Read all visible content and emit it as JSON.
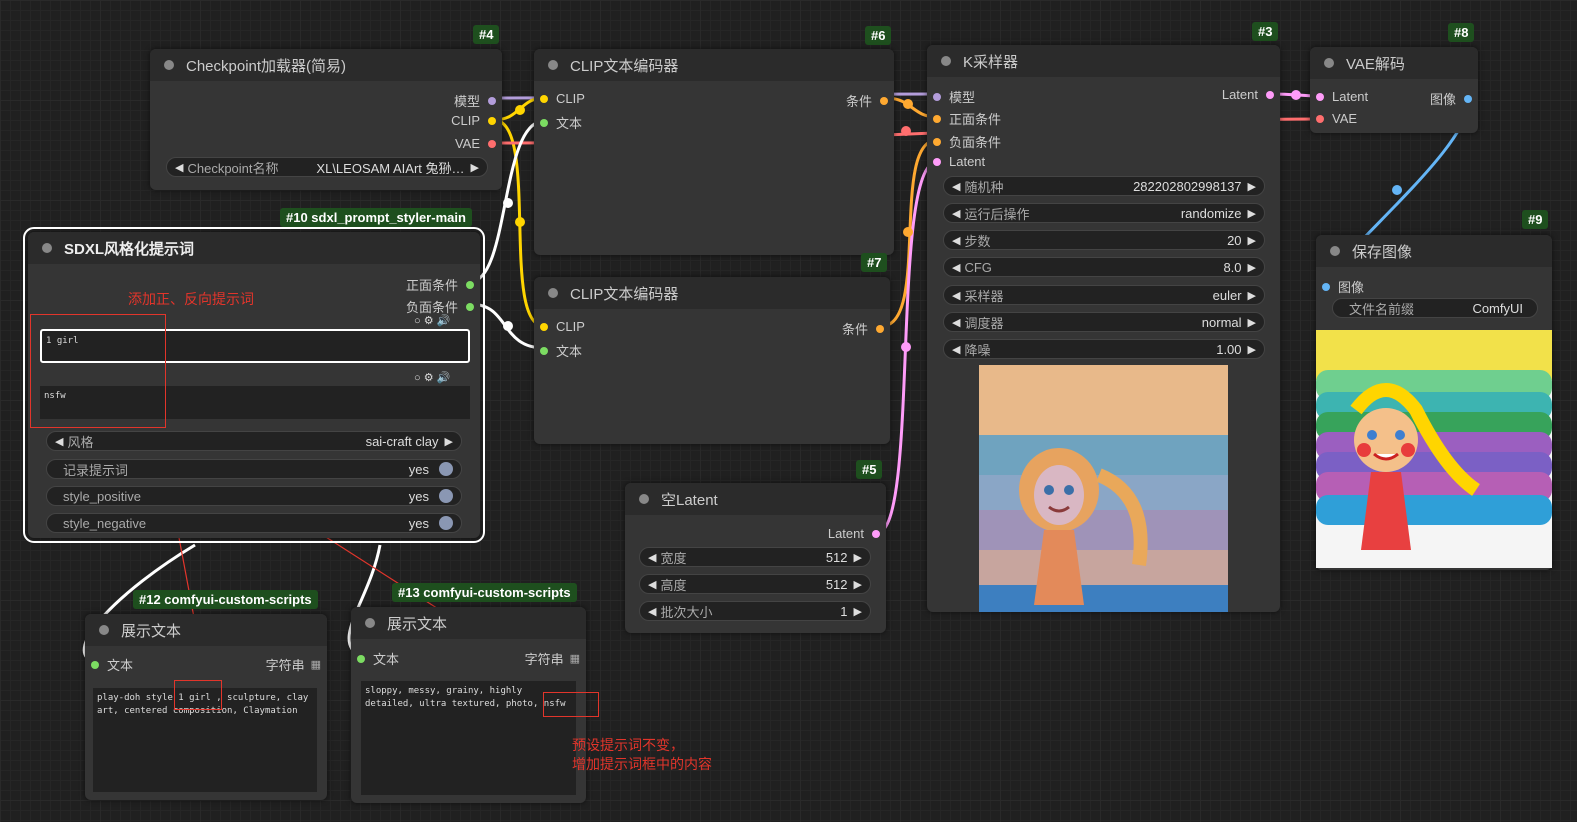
{
  "colors": {
    "model": "#b39ddb",
    "clip": "#ffd500",
    "vae": "#ff6e6e",
    "cond": "#ffa931",
    "latent": "#ff9cf9",
    "image": "#64b5f6",
    "string": "#7cdc62",
    "badge": "#1e4f1e",
    "annot": "#e2352b"
  },
  "nodes": {
    "n4": {
      "badge": "#4",
      "title": "Checkpoint加载器(简易)",
      "out_model": "模型",
      "out_clip": "CLIP",
      "out_vae": "VAE",
      "widget_label": "Checkpoint名称",
      "widget_value": "XL\\LEOSAM AIArt 兔狲…"
    },
    "n6": {
      "badge": "#6",
      "title": "CLIP文本编码器",
      "in_clip": "CLIP",
      "in_text": "文本",
      "out_cond": "条件"
    },
    "n7": {
      "badge": "#7",
      "title": "CLIP文本编码器",
      "in_clip": "CLIP",
      "in_text": "文本",
      "out_cond": "条件"
    },
    "n3": {
      "badge": "#3",
      "title": "K采样器",
      "in_model": "模型",
      "in_pos": "正面条件",
      "in_neg": "负面条件",
      "in_latent": "Latent",
      "out_latent": "Latent",
      "widgets": [
        {
          "label": "随机种",
          "value": "282202802998137"
        },
        {
          "label": "运行后操作",
          "value": "randomize"
        },
        {
          "label": "步数",
          "value": "20"
        },
        {
          "label": "CFG",
          "value": "8.0"
        },
        {
          "label": "采样器",
          "value": "euler"
        },
        {
          "label": "调度器",
          "value": "normal"
        },
        {
          "label": "降噪",
          "value": "1.00"
        }
      ]
    },
    "n8": {
      "badge": "#8",
      "title": "VAE解码",
      "in_latent": "Latent",
      "in_vae": "VAE",
      "out_image": "图像"
    },
    "n9": {
      "badge": "#9",
      "title": "保存图像",
      "in_image": "图像",
      "widget_label": "文件名前缀",
      "widget_value": "ComfyUI"
    },
    "n10": {
      "badge": "#10 sdxl_prompt_styler-main",
      "title": "SDXL风格化提示词",
      "out_pos": "正面条件",
      "out_neg": "负面条件",
      "text_pos": "1 girl",
      "text_neg": "nsfw",
      "widgets": [
        {
          "label": "风格",
          "value": "sai-craft clay"
        },
        {
          "label": "记录提示词",
          "value": "yes"
        },
        {
          "label": "style_positive",
          "value": "yes"
        },
        {
          "label": "style_negative",
          "value": "yes"
        }
      ]
    },
    "n5": {
      "badge": "#5",
      "title": "空Latent",
      "out_latent": "Latent",
      "widgets": [
        {
          "label": "宽度",
          "value": "512"
        },
        {
          "label": "高度",
          "value": "512"
        },
        {
          "label": "批次大小",
          "value": "1"
        }
      ]
    },
    "n12": {
      "badge": "#12 comfyui-custom-scripts",
      "title": "展示文本",
      "in_text": "文本",
      "out_string": "字符串",
      "text": "play-doh style 1 girl , sculpture, clay art, centered composition, Claymation"
    },
    "n13": {
      "badge": "#13 comfyui-custom-scripts",
      "title": "展示文本",
      "in_text": "文本",
      "out_string": "字符串",
      "text": "sloppy, messy, grainy, highly detailed, ultra textured, photo, nsfw"
    }
  },
  "annotations": {
    "a1": "添加正、反向提示词",
    "a2_line1": "预设提示词不变，",
    "a2_line2": "增加提示词框中的内容"
  },
  "icons": {
    "refresh": "○",
    "gear": "⚙",
    "speaker": "🔊"
  }
}
